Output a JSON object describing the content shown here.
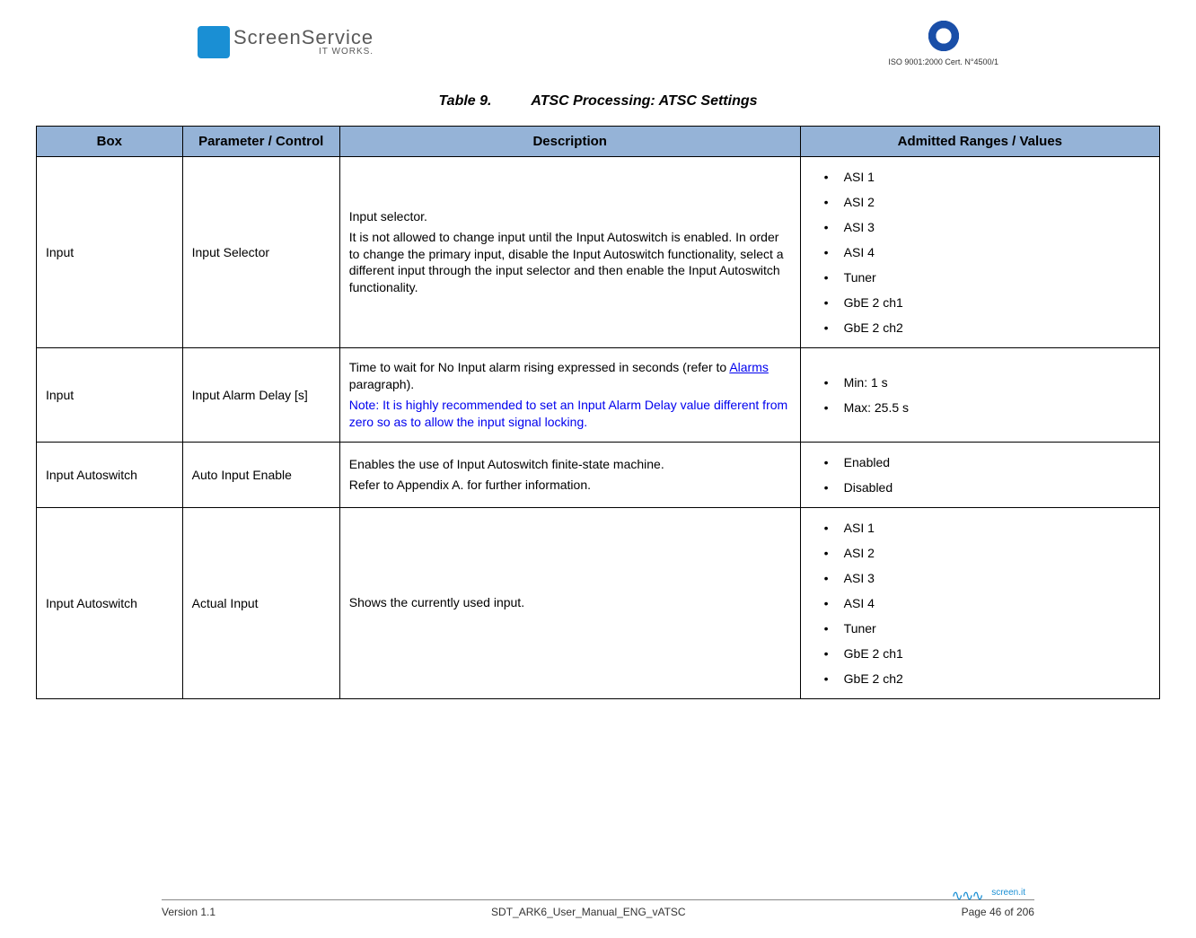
{
  "header": {
    "logo_main": "ScreenService",
    "logo_sub": "IT WORKS.",
    "iso_text": "ISO 9001:2000 Cert. N°4500/1"
  },
  "title": {
    "number": "Table 9.",
    "text": "ATSC Processing: ATSC Settings"
  },
  "columns": {
    "c0": "Box",
    "c1": "Parameter / Control",
    "c2": "Description",
    "c3": "Admitted Ranges / Values"
  },
  "rows": [
    {
      "box": "Input",
      "param": "Input Selector",
      "desc": {
        "p1": "Input selector.",
        "p2": "It is not allowed to change input until the Input Autoswitch is enabled. In order to change the primary input, disable the Input Autoswitch functionality, select a different input through the input selector and then enable the Input Autoswitch functionality."
      },
      "values": [
        "ASI 1",
        "ASI 2",
        "ASI 3",
        "ASI 4",
        "Tuner",
        "GbE 2 ch1",
        "GbE 2 ch2"
      ]
    },
    {
      "box": "Input",
      "param": "Input Alarm Delay [s]",
      "desc": {
        "p1_pre": "Time to wait for No Input alarm rising expressed in seconds (refer to ",
        "p1_link": "Alarms",
        "p1_post": " paragraph).",
        "note": "Note: It is highly recommended to set an Input Alarm Delay value different from zero so as to allow the input signal locking."
      },
      "values": [
        "Min: 1 s",
        "Max: 25.5 s"
      ]
    },
    {
      "box": "Input Autoswitch",
      "param": "Auto Input Enable",
      "desc": {
        "p1": "Enables the use of Input Autoswitch finite-state machine.",
        "p2": "Refer to Appendix A. for further information."
      },
      "values": [
        "Enabled",
        "Disabled"
      ]
    },
    {
      "box": "Input Autoswitch",
      "param": "Actual Input",
      "desc": {
        "p1": "Shows the currently used input."
      },
      "values": [
        "ASI 1",
        "ASI 2",
        "ASI 3",
        "ASI 4",
        "Tuner",
        "GbE 2 ch1",
        "GbE 2 ch2"
      ]
    }
  ],
  "footer": {
    "version": "Version 1.1",
    "docname": "SDT_ARK6_User_Manual_ENG_vATSC",
    "page": "Page 46 of 206",
    "sig": "screen.it"
  }
}
